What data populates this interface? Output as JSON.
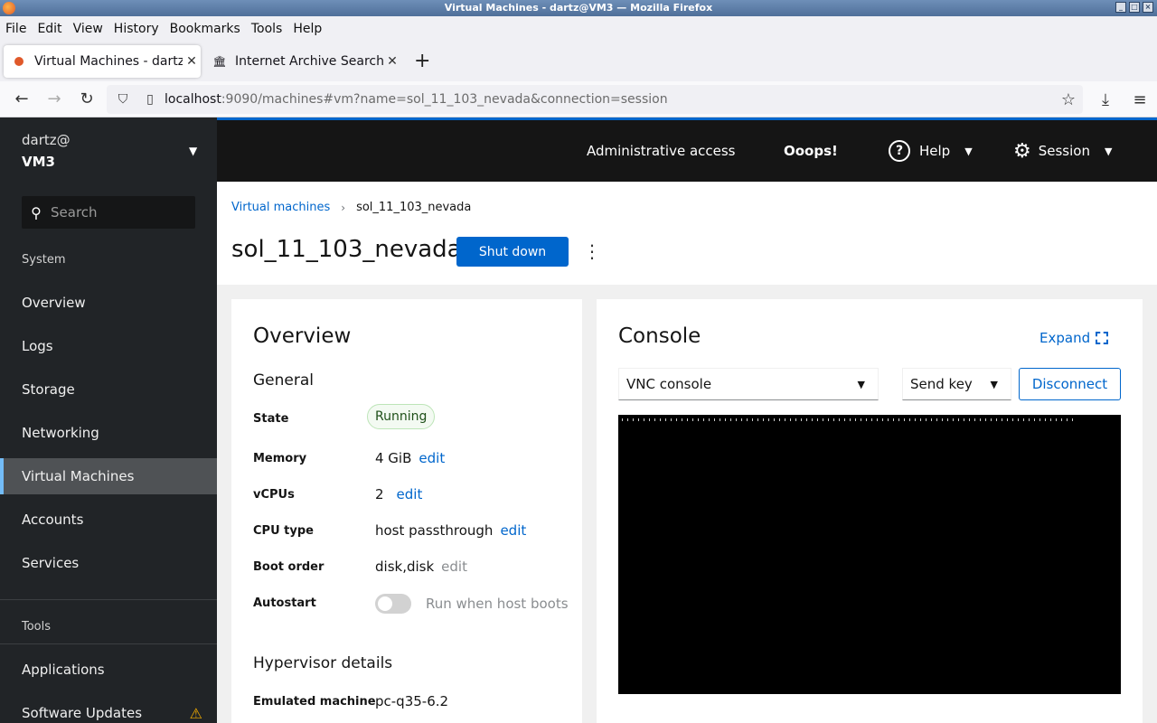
{
  "window": {
    "title": "Virtual Machines - dartz@VM3 — Mozilla Firefox"
  },
  "menubar": [
    "File",
    "Edit",
    "View",
    "History",
    "Bookmarks",
    "Tools",
    "Help"
  ],
  "tabs": [
    {
      "label": "Virtual Machines - dartz@",
      "active": true
    },
    {
      "label": "Internet Archive Search:",
      "active": false
    }
  ],
  "url": {
    "host": "localhost",
    "path": ":9090/machines#vm?name=sol_11_103_nevada&connection=session"
  },
  "sidebar": {
    "user": "dartz@",
    "host": "VM3",
    "search_placeholder": "Search",
    "section_system": "System",
    "system_items": [
      "Overview",
      "Logs",
      "Storage",
      "Networking",
      "Virtual Machines",
      "Accounts",
      "Services"
    ],
    "active_item": "Virtual Machines",
    "section_tools": "Tools",
    "tools_items": [
      "Applications",
      "Software Updates"
    ]
  },
  "topbar": {
    "admin": "Administrative access",
    "oops": "Ooops!",
    "help": "Help",
    "session": "Session"
  },
  "breadcrumb": {
    "parent": "Virtual machines",
    "current": "sol_11_103_nevada"
  },
  "vm": {
    "name": "sol_11_103_nevada",
    "shutdown_label": "Shut down"
  },
  "overview": {
    "title": "Overview",
    "general": "General",
    "rows": {
      "state_label": "State",
      "state_value": "Running",
      "memory_label": "Memory",
      "memory_value": "4 GiB",
      "vcpus_label": "vCPUs",
      "vcpus_value": "2",
      "cputype_label": "CPU type",
      "cputype_value": "host passthrough",
      "bootorder_label": "Boot order",
      "bootorder_value": "disk,disk",
      "autostart_label": "Autostart",
      "autostart_text": "Run when host boots",
      "edit": "edit"
    },
    "hypervisor": "Hypervisor details",
    "emulated_label": "Emulated machine",
    "emulated_value": "pc-q35-6.2"
  },
  "console": {
    "title": "Console",
    "expand": "Expand",
    "type_selected": "VNC console",
    "send_key": "Send key",
    "disconnect": "Disconnect"
  },
  "colors": {
    "accent": "#0066cc",
    "sidebar_bg": "#212427",
    "header_bg": "#151515",
    "danger": "#c9190b",
    "warning": "#f0ab00"
  }
}
